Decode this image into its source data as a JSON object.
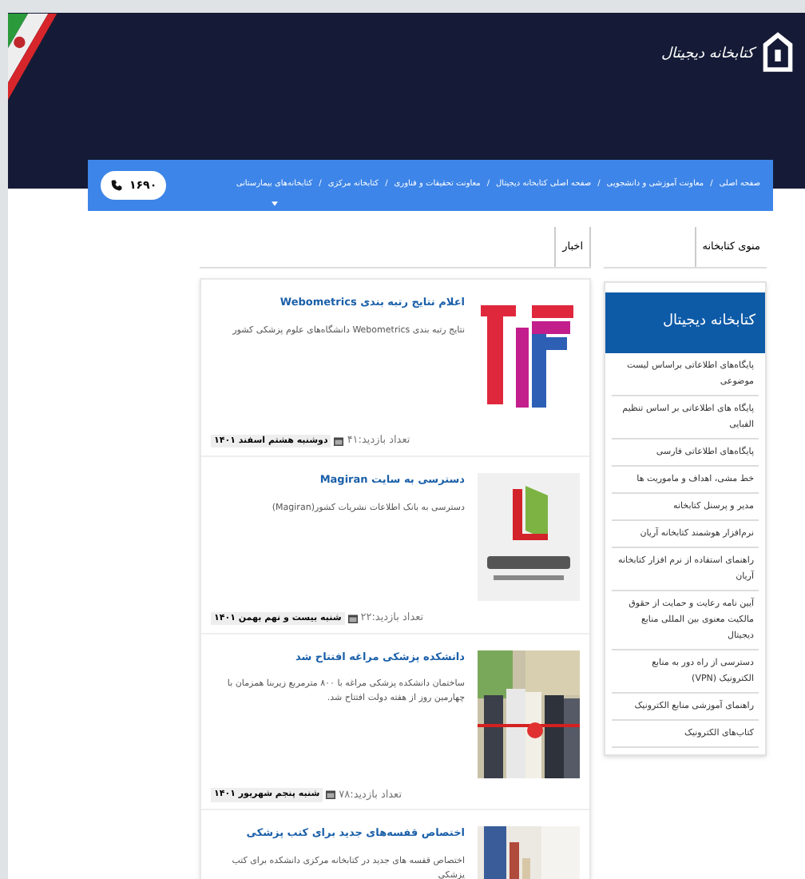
{
  "header": {
    "logo_text": "کتابخانه دیجیتال"
  },
  "nav": {
    "items": [
      "صفحه اصلی",
      "معاونت آموزشی و دانشجویی",
      "صفحه اصلی کتابخانه دیجیتال",
      "معاونت تحقیقات و فناوری",
      "کتابخانه مرکزی",
      "کتابخانه‌های بیمارستانی"
    ],
    "separator": "/",
    "phone": "۱۶۹۰"
  },
  "sidebar": {
    "tab": "منوی کتابخانه",
    "title": "کتابخانه دیجیتال",
    "items": [
      "پایگاه‌های اطلاعاتی براساس لیست موضوعی",
      "پایگاه های اطلاعاتی بر اساس تنظیم الفبایی",
      "پایگاه‌های اطلاعاتی فارسی",
      "خط مشی، اهداف و ماموریت ها",
      "مدیر و پرسنل کتابخانه",
      "نرم‌افزار هوشمند کتابخانه آریان",
      "راهنمای استفاده از نرم افزار کتابخانه آریان",
      "آیین نامه رعایت و حمایت از حقوق مالکیت معنوی بین المللی منابع دیجیتال",
      "دسترسی از راه دور به منابع الکترونیک (VPN)",
      "راهنمای آموزشی منابع الکترونیک",
      "کتاب‌های الکترونیک"
    ]
  },
  "news": {
    "tab": "اخبار",
    "items": [
      {
        "title": "اعلام نتایج رتبه بندی Webometrics",
        "summary": "نتایج رتبه بندی Webometrics دانشگاه‌های علوم پزشکی کشور",
        "visits": "تعداد بازدید:۴۱",
        "date": "دوشنبه هشتم اسفند ۱۴۰۱"
      },
      {
        "title": "دسترسی به سایت Magiran",
        "summary": "دسترسی به بانک اطلاعات نشریات کشور(Magiran)",
        "visits": "تعداد بازدید:۲۲",
        "date": "شنبه بیست و نهم بهمن ۱۴۰۱"
      },
      {
        "title": "دانشکده پزشکی مراغه افتتاح شد",
        "summary": "ساختمان دانشکده پزشکی مراغه با ۸۰۰ مترمربع زیربنا همزمان با چهارمین روز از هفته دولت افتتاح شد.",
        "visits": "تعداد بازدید:۷۸",
        "date": "شنبه پنجم شهریور ۱۴۰۱"
      },
      {
        "title": "اختصاص قفسه‌های جدید برای کتب پزشکی",
        "summary": "اختصاص قفسه های جدید در کتابخانه مرکزی دانشکده برای کتب پزشکی"
      }
    ]
  }
}
